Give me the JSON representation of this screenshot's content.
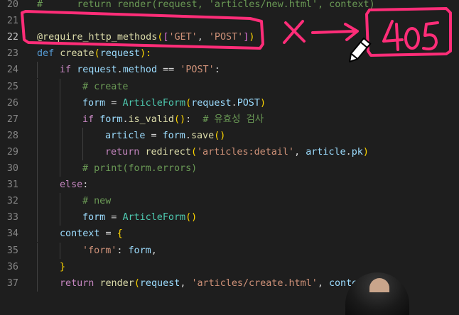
{
  "editor": {
    "lines": [
      {
        "num": "20",
        "indent": 0,
        "tokens": [
          {
            "t": "#      return render(request, 'articles/new.html', context)",
            "c": "com"
          }
        ]
      },
      {
        "num": "21",
        "indent": 0,
        "tokens": []
      },
      {
        "num": "22",
        "indent": 0,
        "active": true,
        "tokens": [
          {
            "t": "@require_http_methods",
            "c": "deco"
          },
          {
            "t": "(",
            "c": "brk"
          },
          {
            "t": "[",
            "c": "brk2"
          },
          {
            "t": "'GET'",
            "c": "str"
          },
          {
            "t": ", ",
            "c": "pn"
          },
          {
            "t": "'POST'",
            "c": "str"
          },
          {
            "t": "]",
            "c": "brk2"
          },
          {
            "t": ")",
            "c": "brk"
          }
        ]
      },
      {
        "num": "23",
        "indent": 0,
        "tokens": [
          {
            "t": "def ",
            "c": "kw"
          },
          {
            "t": "create",
            "c": "fn"
          },
          {
            "t": "(",
            "c": "brk"
          },
          {
            "t": "request",
            "c": "var"
          },
          {
            "t": "):",
            "c": "brk"
          }
        ]
      },
      {
        "num": "24",
        "indent": 1,
        "tokens": [
          {
            "t": "if ",
            "c": "ctl"
          },
          {
            "t": "request",
            "c": "var"
          },
          {
            "t": ".",
            "c": "pn"
          },
          {
            "t": "method",
            "c": "var"
          },
          {
            "t": " == ",
            "c": "op"
          },
          {
            "t": "'POST'",
            "c": "str"
          },
          {
            "t": ":",
            "c": "pn"
          }
        ]
      },
      {
        "num": "25",
        "indent": 2,
        "tokens": [
          {
            "t": "# create",
            "c": "com"
          }
        ]
      },
      {
        "num": "26",
        "indent": 2,
        "tokens": [
          {
            "t": "form",
            "c": "var"
          },
          {
            "t": " = ",
            "c": "op"
          },
          {
            "t": "ArticleForm",
            "c": "cls"
          },
          {
            "t": "(",
            "c": "brk"
          },
          {
            "t": "request",
            "c": "var"
          },
          {
            "t": ".",
            "c": "pn"
          },
          {
            "t": "POST",
            "c": "var"
          },
          {
            "t": ")",
            "c": "brk"
          }
        ]
      },
      {
        "num": "27",
        "indent": 2,
        "tokens": [
          {
            "t": "if ",
            "c": "ctl"
          },
          {
            "t": "form",
            "c": "var"
          },
          {
            "t": ".",
            "c": "pn"
          },
          {
            "t": "is_valid",
            "c": "fn"
          },
          {
            "t": "()",
            "c": "brk"
          },
          {
            "t": ":  ",
            "c": "pn"
          },
          {
            "t": "# 유효성 검사",
            "c": "com"
          }
        ]
      },
      {
        "num": "28",
        "indent": 3,
        "tokens": [
          {
            "t": "article",
            "c": "var"
          },
          {
            "t": " = ",
            "c": "op"
          },
          {
            "t": "form",
            "c": "var"
          },
          {
            "t": ".",
            "c": "pn"
          },
          {
            "t": "save",
            "c": "fn"
          },
          {
            "t": "()",
            "c": "brk"
          }
        ]
      },
      {
        "num": "29",
        "indent": 3,
        "tokens": [
          {
            "t": "return ",
            "c": "ctl"
          },
          {
            "t": "redirect",
            "c": "fn"
          },
          {
            "t": "(",
            "c": "brk"
          },
          {
            "t": "'articles:detail'",
            "c": "str"
          },
          {
            "t": ", ",
            "c": "pn"
          },
          {
            "t": "article",
            "c": "var"
          },
          {
            "t": ".",
            "c": "pn"
          },
          {
            "t": "pk",
            "c": "var"
          },
          {
            "t": ")",
            "c": "brk"
          }
        ]
      },
      {
        "num": "30",
        "indent": 2,
        "tokens": [
          {
            "t": "# print(form.errors)",
            "c": "com"
          }
        ]
      },
      {
        "num": "31",
        "indent": 1,
        "tokens": [
          {
            "t": "else",
            "c": "ctl"
          },
          {
            "t": ":",
            "c": "pn"
          }
        ]
      },
      {
        "num": "32",
        "indent": 2,
        "tokens": [
          {
            "t": "# new",
            "c": "com"
          }
        ]
      },
      {
        "num": "33",
        "indent": 2,
        "tokens": [
          {
            "t": "form",
            "c": "var"
          },
          {
            "t": " = ",
            "c": "op"
          },
          {
            "t": "ArticleForm",
            "c": "cls"
          },
          {
            "t": "()",
            "c": "brk"
          }
        ]
      },
      {
        "num": "34",
        "indent": 1,
        "tokens": [
          {
            "t": "context",
            "c": "var"
          },
          {
            "t": " = ",
            "c": "op"
          },
          {
            "t": "{",
            "c": "brk"
          }
        ]
      },
      {
        "num": "35",
        "indent": 2,
        "tokens": [
          {
            "t": "'form'",
            "c": "str"
          },
          {
            "t": ": ",
            "c": "pn"
          },
          {
            "t": "form",
            "c": "var"
          },
          {
            "t": ",",
            "c": "pn"
          }
        ]
      },
      {
        "num": "36",
        "indent": 1,
        "tokens": [
          {
            "t": "}",
            "c": "brk"
          }
        ]
      },
      {
        "num": "37",
        "indent": 1,
        "tokens": [
          {
            "t": "return ",
            "c": "ctl"
          },
          {
            "t": "render",
            "c": "fn"
          },
          {
            "t": "(",
            "c": "brk"
          },
          {
            "t": "request",
            "c": "var"
          },
          {
            "t": ", ",
            "c": "pn"
          },
          {
            "t": "'articles/create.html'",
            "c": "str"
          },
          {
            "t": ", ",
            "c": "pn"
          },
          {
            "t": "context",
            "c": "var"
          },
          {
            "t": ")",
            "c": "brk"
          }
        ]
      }
    ]
  },
  "annotation": {
    "handwritten_text": "405",
    "ink_color": "#ff2d78",
    "pencil_icon": "pencil-icon"
  }
}
